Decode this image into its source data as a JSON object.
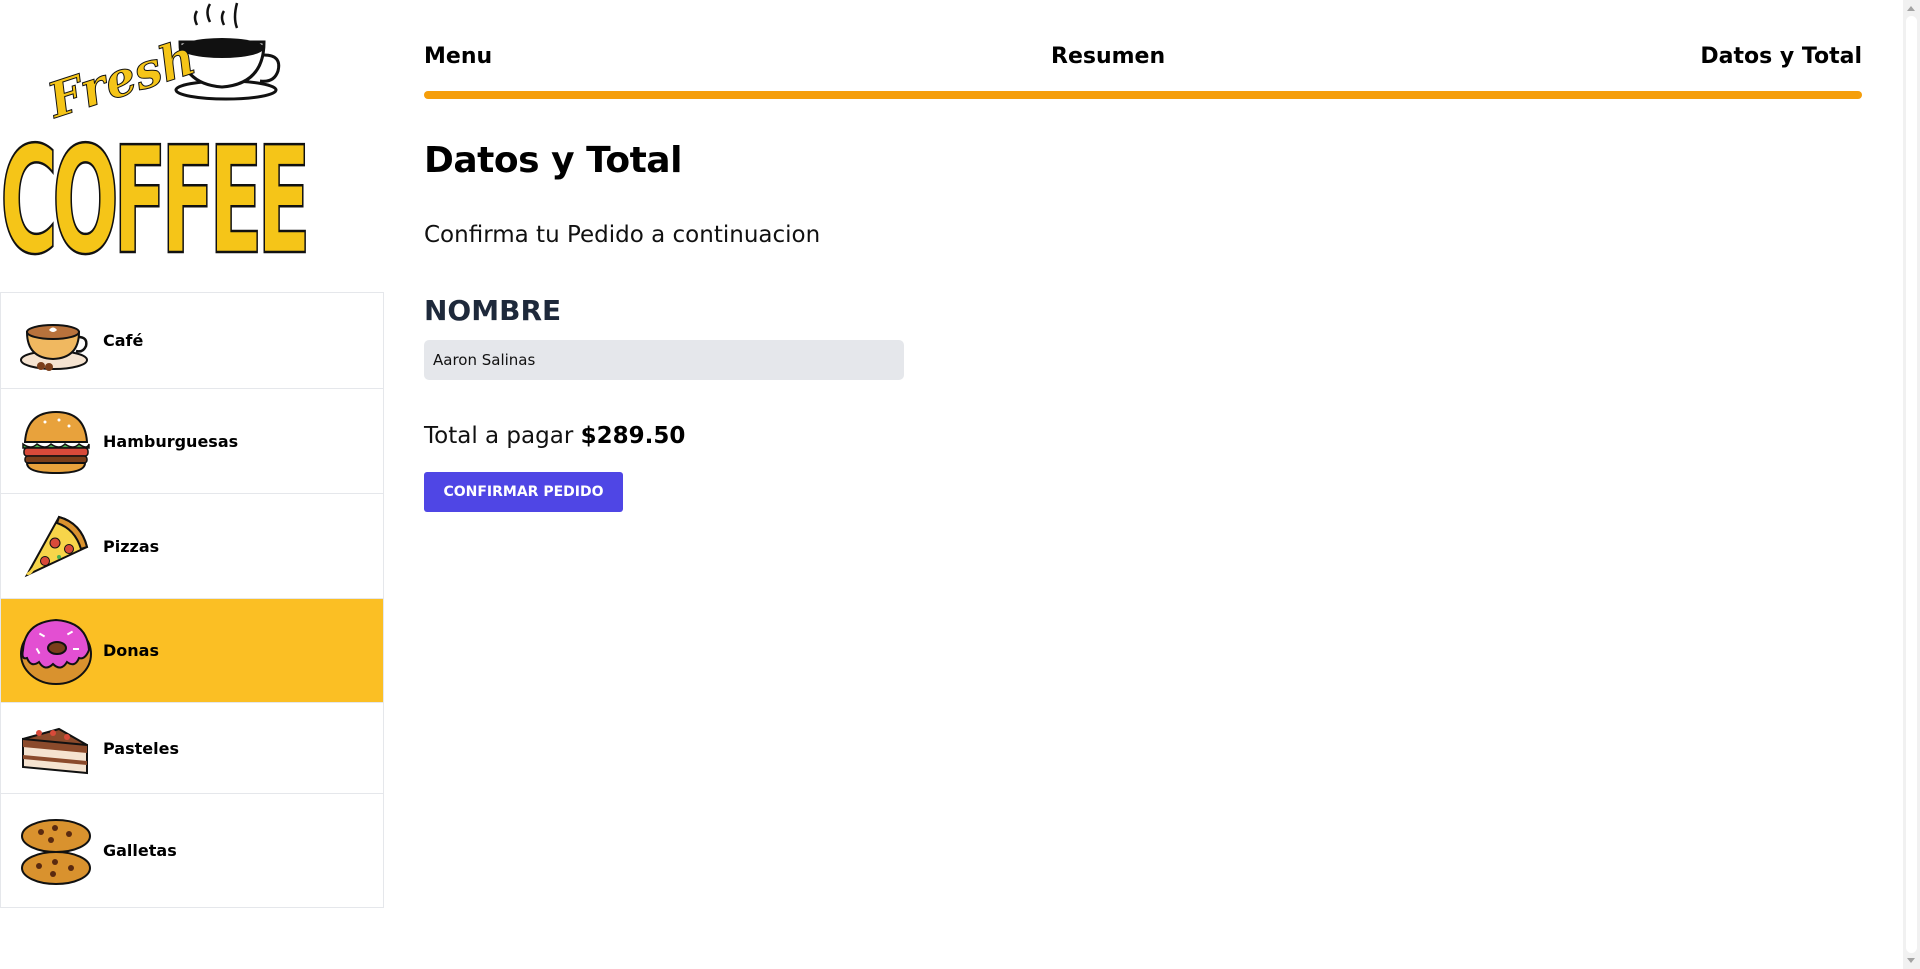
{
  "logo": {
    "word_top": "Fresh",
    "word_main": "COFFEE"
  },
  "categories": [
    {
      "label": "Café",
      "icon": "coffee-cup-icon",
      "active": false
    },
    {
      "label": "Hamburguesas",
      "icon": "burger-icon",
      "active": false
    },
    {
      "label": "Pizzas",
      "icon": "pizza-slice-icon",
      "active": false
    },
    {
      "label": "Donas",
      "icon": "donut-icon",
      "active": true
    },
    {
      "label": "Pasteles",
      "icon": "cake-slice-icon",
      "active": false
    },
    {
      "label": "Galletas",
      "icon": "cookies-icon",
      "active": false
    }
  ],
  "steps": [
    {
      "label": "Menu"
    },
    {
      "label": "Resumen"
    },
    {
      "label": "Datos y Total"
    }
  ],
  "progress": {
    "percent": 100
  },
  "form": {
    "title": "Datos y Total",
    "subtitle": "Confirma tu Pedido a continuacion",
    "name_label": "NOMBRE",
    "name_value": "Aaron Salinas",
    "total_prefix": "Total a pagar",
    "total_amount": "$289.50",
    "submit_label": "CONFIRMAR PEDIDO"
  },
  "colors": {
    "accent": "#f59e0b",
    "active_category": "#fbbf24",
    "button": "#4f46e5",
    "input_bg": "#e5e7eb"
  }
}
